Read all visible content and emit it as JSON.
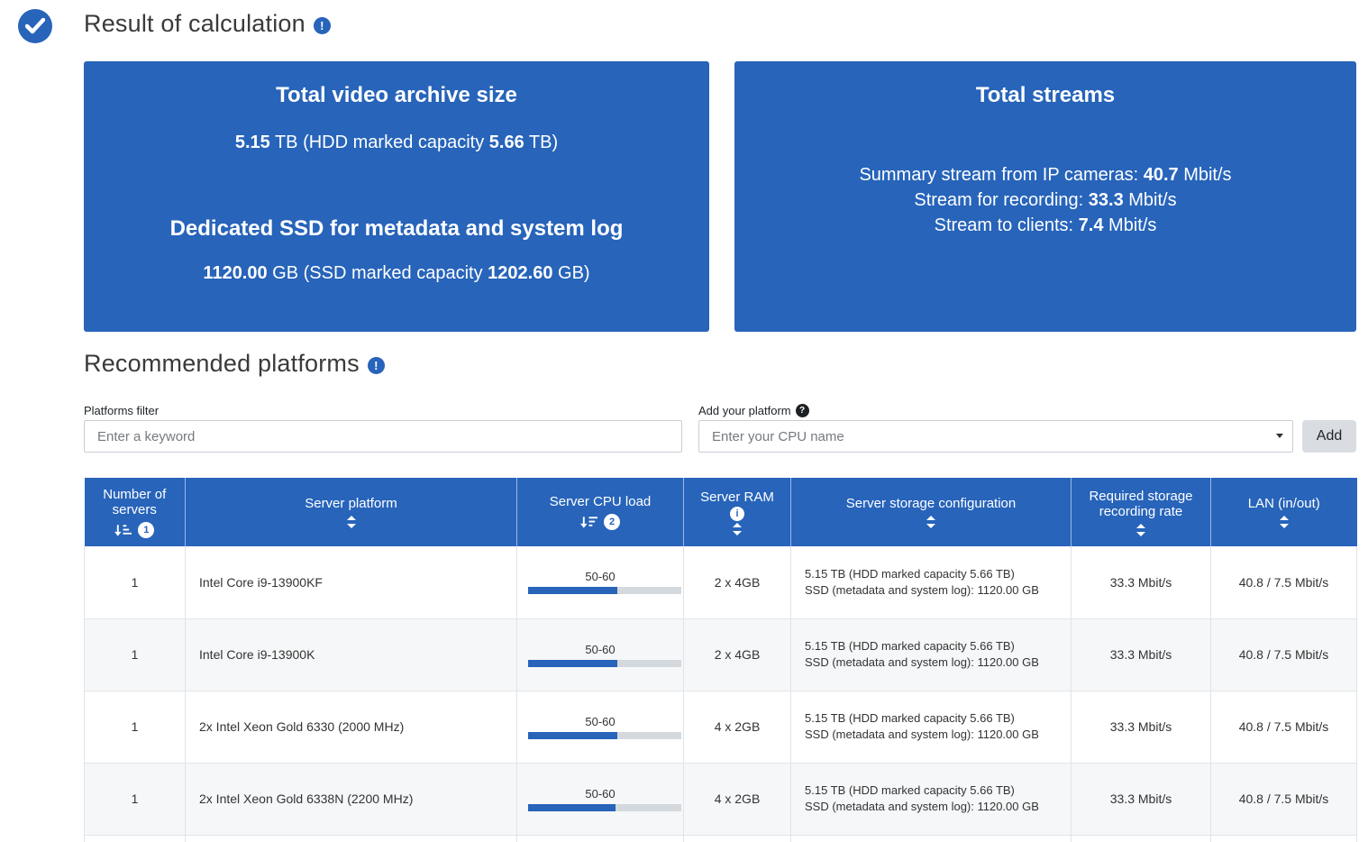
{
  "colors": {
    "primary_blue": "#2764ba",
    "row_stripe": "#f6f7f8",
    "progress_track": "#d4d9de"
  },
  "icons": {
    "check": "✓",
    "info_exclamation": "!",
    "help_question": "?",
    "ram_info": "i",
    "dropdown_caret": "▾"
  },
  "header": {
    "title": "Result of calculation"
  },
  "cards": {
    "archive": {
      "title": "Total video archive size",
      "hdd_line": {
        "v1": "5.15",
        "mid": " TB (HDD marked capacity ",
        "v2": "5.66",
        "end": " TB)"
      },
      "ssd_title": "Dedicated SSD for metadata and system log",
      "ssd_line": {
        "v1": "1120.00",
        "mid": " GB (SSD marked capacity ",
        "v2": "1202.60",
        "end": " GB)"
      }
    },
    "streams": {
      "title": "Total streams",
      "lines": [
        {
          "label": "Summary stream from IP cameras: ",
          "value": "40.7",
          "unit": " Mbit/s"
        },
        {
          "label": "Stream for recording: ",
          "value": "33.3",
          "unit": " Mbit/s"
        },
        {
          "label": "Stream to clients: ",
          "value": "7.4",
          "unit": " Mbit/s"
        }
      ]
    }
  },
  "platforms": {
    "heading": "Recommended platforms",
    "filter_label": "Platforms filter",
    "filter_placeholder": "Enter a keyword",
    "add_label": "Add your platform",
    "add_placeholder": "Enter your CPU name",
    "add_button": "Add"
  },
  "table": {
    "columns": [
      {
        "label": "Number of servers",
        "sort_badge": "1"
      },
      {
        "label": "Server platform"
      },
      {
        "label": "Server CPU load",
        "sort_badge": "2"
      },
      {
        "label": "Server RAM"
      },
      {
        "label": "Server storage configuration"
      },
      {
        "label": "Required storage recording rate"
      },
      {
        "label": "LAN (in/out)"
      }
    ],
    "rows": [
      {
        "servers": "1",
        "platform": "Intel Core i9-13900KF",
        "cpu_label": "50-60",
        "cpu_pct": 58,
        "ram": "2 x 4GB",
        "storage_line1": "5.15 TB (HDD marked capacity 5.66 TB)",
        "storage_line2": "SSD (metadata and system log): 1120.00 GB",
        "rate": "33.3 Mbit/s",
        "lan": "40.8 / 7.5 Mbit/s"
      },
      {
        "servers": "1",
        "platform": "Intel Core i9-13900K",
        "cpu_label": "50-60",
        "cpu_pct": 58,
        "ram": "2 x 4GB",
        "storage_line1": "5.15 TB (HDD marked capacity 5.66 TB)",
        "storage_line2": "SSD (metadata and system log): 1120.00 GB",
        "rate": "33.3 Mbit/s",
        "lan": "40.8 / 7.5 Mbit/s"
      },
      {
        "servers": "1",
        "platform": "2x Intel Xeon Gold 6330 (2000 MHz)",
        "cpu_label": "50-60",
        "cpu_pct": 58,
        "ram": "4 x 2GB",
        "storage_line1": "5.15 TB (HDD marked capacity 5.66 TB)",
        "storage_line2": "SSD (metadata and system log): 1120.00 GB",
        "rate": "33.3 Mbit/s",
        "lan": "40.8 / 7.5 Mbit/s"
      },
      {
        "servers": "1",
        "platform": "2x Intel Xeon Gold 6338N (2200 MHz)",
        "cpu_label": "50-60",
        "cpu_pct": 57,
        "ram": "4 x 2GB",
        "storage_line1": "5.15 TB (HDD marked capacity 5.66 TB)",
        "storage_line2": "SSD (metadata and system log): 1120.00 GB",
        "rate": "33.3 Mbit/s",
        "lan": "40.8 / 7.5 Mbit/s"
      }
    ]
  }
}
